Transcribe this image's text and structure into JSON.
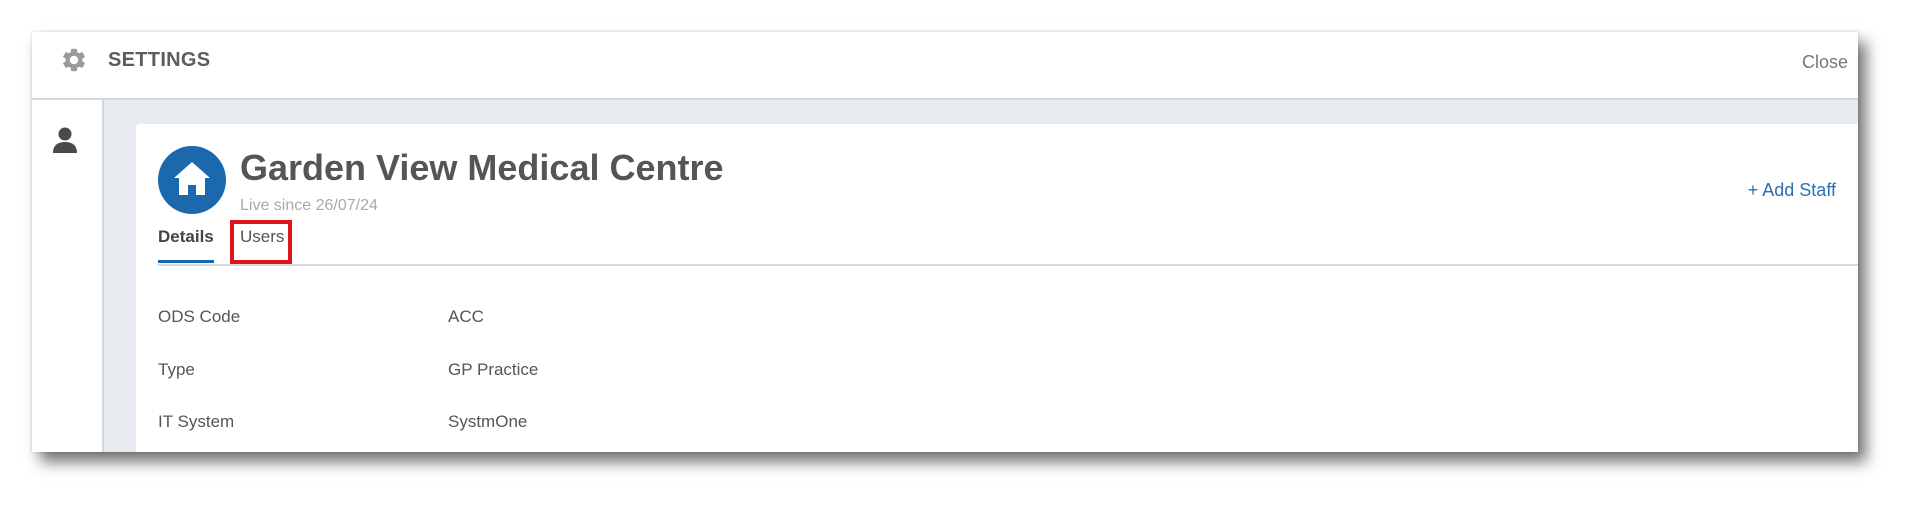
{
  "header": {
    "title": "SETTINGS",
    "close_label": "Close",
    "settings_icon": "gear-icon"
  },
  "sidebar": {
    "items": [
      {
        "icon": "user-icon"
      }
    ]
  },
  "organisation": {
    "name": "Garden View Medical Centre",
    "subtitle": "Live since 26/07/24",
    "avatar_icon": "home-icon",
    "avatar_color": "#1b68ad",
    "add_staff_label": "+ Add Staff"
  },
  "tabs": [
    {
      "label": "Details",
      "active": true
    },
    {
      "label": "Users",
      "active": false,
      "highlighted": true
    }
  ],
  "details": [
    {
      "label": "ODS Code",
      "value": "ACC"
    },
    {
      "label": "Type",
      "value": "GP Practice"
    },
    {
      "label": "IT System",
      "value": "SystmOne"
    }
  ],
  "colors": {
    "accent": "#1b68ad",
    "link": "#2c6fb0",
    "highlight_box": "#e1141e",
    "content_background": "#e8ebef"
  }
}
